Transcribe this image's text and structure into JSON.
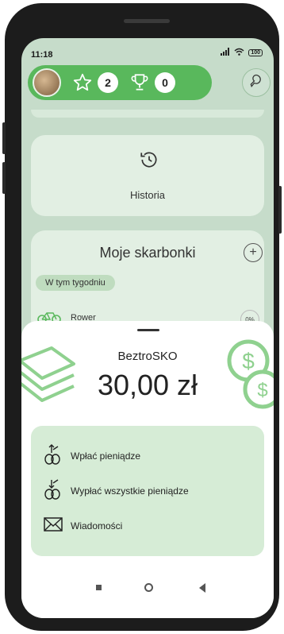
{
  "status_bar": {
    "time": "11:18",
    "battery": "100"
  },
  "top_bar": {
    "stars_count": "2",
    "trophies_count": "0"
  },
  "history": {
    "label": "Historia"
  },
  "savings": {
    "header": "Moje skarbonki",
    "week_chip": "W tym tygodniu",
    "items": [
      {
        "name": "Rower",
        "percent": "0%"
      }
    ]
  },
  "sheet": {
    "title": "BeztroSKO",
    "amount": "30,00 zł",
    "actions": [
      {
        "label": "Wpłać pieniądze",
        "icon": "deposit-coins-icon"
      },
      {
        "label": "Wypłać wszystkie pieniądze",
        "icon": "withdraw-coins-icon"
      },
      {
        "label": "Wiadomości",
        "icon": "envelope-icon"
      }
    ]
  },
  "colors": {
    "accent": "#59b85c",
    "sheet_panel": "#d6ecd6",
    "background": "#c6dcca"
  }
}
